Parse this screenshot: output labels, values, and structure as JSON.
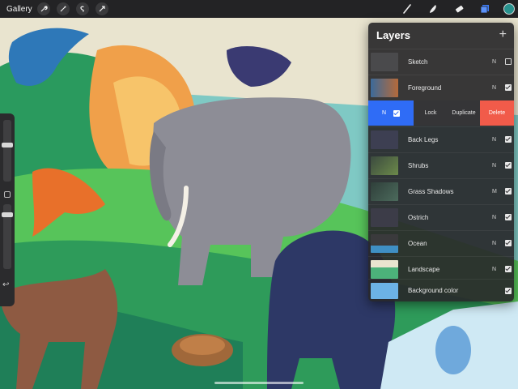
{
  "toolbar": {
    "gallery_label": "Gallery",
    "left_tools": [
      "wrench-icon",
      "wand-icon",
      "selection-icon",
      "transform-arrow-icon"
    ],
    "right_tools": [
      "brush-icon",
      "smudge-icon",
      "eraser-icon",
      "layers-icon"
    ],
    "active_color": "#28928e"
  },
  "sidebar": {
    "undo_glyph": "↩"
  },
  "layers_panel": {
    "title": "Layers",
    "add_glyph": "+",
    "swipe_actions": {
      "mode": "N",
      "lock": "Lock",
      "duplicate": "Duplicate",
      "delete": "Delete"
    },
    "layers": [
      {
        "name": "Sketch",
        "mode": "N",
        "visible": false
      },
      {
        "name": "Foreground",
        "mode": "N",
        "visible": true
      },
      {
        "name": "Back Legs",
        "mode": "N",
        "visible": true
      },
      {
        "name": "Shrubs",
        "mode": "N",
        "visible": true
      },
      {
        "name": "Grass Shadows",
        "mode": "M",
        "visible": true
      },
      {
        "name": "Ostrich",
        "mode": "N",
        "visible": true
      },
      {
        "name": "Ocean",
        "mode": "N",
        "visible": true
      },
      {
        "name": "Landscape",
        "mode": "N",
        "visible": true
      }
    ],
    "background": {
      "name": "Background color",
      "color": "#6cb2e6",
      "visible": true
    }
  },
  "colors": {
    "selected_row": "#2f6cf6",
    "delete": "#f15b4a"
  }
}
